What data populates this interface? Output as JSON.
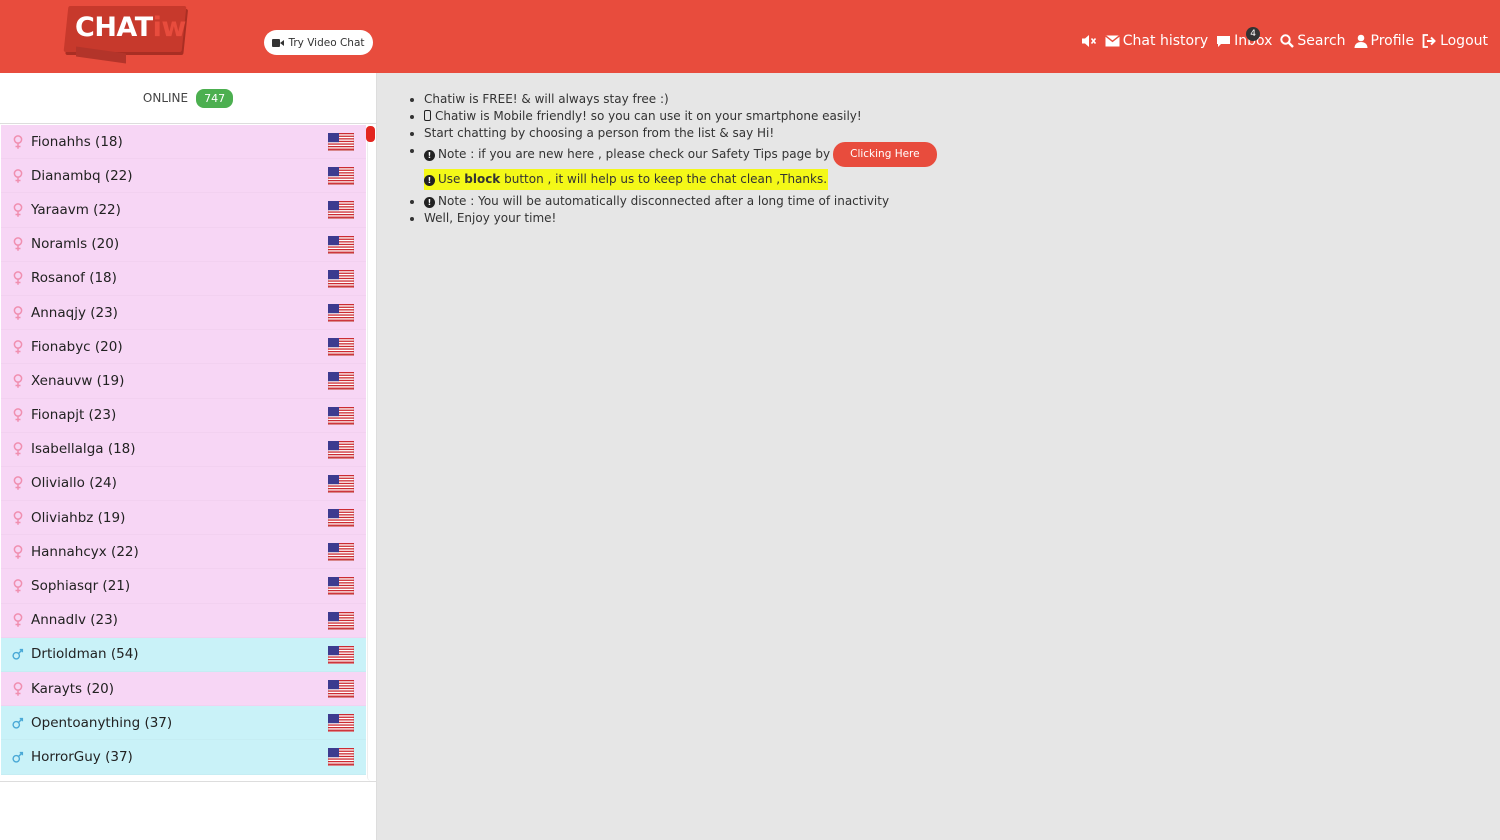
{
  "header": {
    "logo_main": "CHAT",
    "logo_tail": "iw",
    "video_button": "Try Video Chat",
    "nav": {
      "chat_history": "Chat history",
      "inbox": "Inbox",
      "inbox_badge": "4",
      "search": "Search",
      "profile": "Profile",
      "logout": "Logout"
    },
    "icons": [
      "mute-icon",
      "envelope-icon",
      "comment-icon",
      "search-icon",
      "user-icon",
      "logout-icon"
    ]
  },
  "sidebar": {
    "online_label": "ONLINE",
    "online_count": "747",
    "users": [
      {
        "name": "Fionahhs (18)",
        "gender": "female"
      },
      {
        "name": "Dianambq (22)",
        "gender": "female"
      },
      {
        "name": "Yaraavm (22)",
        "gender": "female"
      },
      {
        "name": "Noramls (20)",
        "gender": "female"
      },
      {
        "name": "Rosanof (18)",
        "gender": "female"
      },
      {
        "name": "Annaqjy (23)",
        "gender": "female"
      },
      {
        "name": "Fionabyc (20)",
        "gender": "female"
      },
      {
        "name": "Xenauvw (19)",
        "gender": "female"
      },
      {
        "name": "Fionapjt (23)",
        "gender": "female"
      },
      {
        "name": "Isabellalga (18)",
        "gender": "female"
      },
      {
        "name": "Oliviallo (24)",
        "gender": "female"
      },
      {
        "name": "Oliviahbz (19)",
        "gender": "female"
      },
      {
        "name": "Hannahcyx (22)",
        "gender": "female"
      },
      {
        "name": "Sophiasqr (21)",
        "gender": "female"
      },
      {
        "name": "Annadlv (23)",
        "gender": "female"
      },
      {
        "name": "Drtioldman (54)",
        "gender": "male"
      },
      {
        "name": "Karayts (20)",
        "gender": "female"
      },
      {
        "name": "Opentoanything (37)",
        "gender": "male"
      },
      {
        "name": "HorrorGuy (37)",
        "gender": "male"
      }
    ]
  },
  "info": {
    "line1": "Chatiw is FREE! & will always stay free :)",
    "line2": "Chatiw is Mobile friendly! so you can use it on your smartphone easily!",
    "line3": "Start chatting by choosing a person from the list & say Hi!",
    "line4": "Note : if you are new here , please check our Safety Tips page by",
    "line4_button": "Clicking Here",
    "highlight_pre": "Use",
    "highlight_bold": "block",
    "highlight_post": "button , it will help us to keep the chat clean ,Thanks.",
    "line5": "Note : You will be automatically disconnected after a long time of inactivity",
    "line6": "Well, Enjoy your time!"
  }
}
